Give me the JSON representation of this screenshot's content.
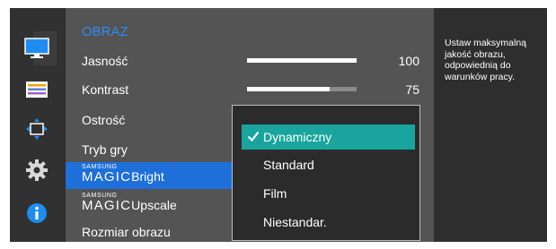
{
  "menu": {
    "title": "OBRAZ",
    "items": [
      {
        "label": "Jasność",
        "value": "100",
        "fill": 1.0
      },
      {
        "label": "Kontrast",
        "value": "75",
        "fill": 0.75
      },
      {
        "label": "Ostrość"
      },
      {
        "label": "Tryb gry"
      },
      {
        "prefix_small": "SAMSUNG",
        "prefix_big": "MAGIC",
        "label": "Bright",
        "selected": true
      },
      {
        "prefix_small": "SAMSUNG",
        "prefix_big": "MAGIC",
        "label": "Upscale"
      },
      {
        "label": "Rozmiar obrazu"
      }
    ]
  },
  "dropdown": {
    "options": [
      "Dynamiczny",
      "Standard",
      "Film",
      "Niestandar."
    ],
    "selected": "Dynamiczny"
  },
  "help": {
    "text": "Ustaw maksymalną jakość obrazu, odpowiednią do warunków pracy."
  },
  "sidebar": {
    "icons": [
      "picture-monitor-icon",
      "color-bars-icon",
      "position-move-icon",
      "settings-gear-icon",
      "info-icon"
    ],
    "active": "picture-monitor-icon"
  },
  "colors": {
    "accent_blue": "#2f8cf0",
    "selected_row": "#1e6fd9",
    "chosen_option": "#19a59e"
  }
}
